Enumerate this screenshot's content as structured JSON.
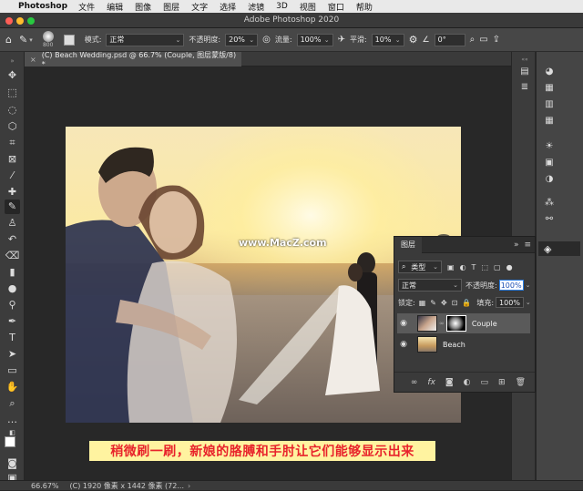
{
  "menubar": {
    "app_name": "Photoshop",
    "items": [
      "文件",
      "编辑",
      "图像",
      "图层",
      "文字",
      "选择",
      "滤镜",
      "3D",
      "视图",
      "窗口",
      "帮助"
    ]
  },
  "window": {
    "title": "Adobe Photoshop 2020"
  },
  "options": {
    "brush_size": "800",
    "mode_label": "模式:",
    "mode_value": "正常",
    "opacity_label": "不透明度:",
    "opacity_value": "20%",
    "flow_label": "流量:",
    "flow_value": "100%",
    "smooth_label": "平滑:",
    "smooth_value": "10%",
    "angle_value": "0°"
  },
  "document_tab": {
    "label": "(C) Beach Wedding.psd @ 66.7% (Couple, 图层蒙版/8) *"
  },
  "canvas": {
    "watermark": "www.MacZ.com",
    "caption": "稍微刷一刷，新娘的胳膊和手肘让它们能够显示出来"
  },
  "layers_panel": {
    "title": "图层",
    "filter_label": "类型",
    "blend_mode": "正常",
    "opacity_label": "不透明度:",
    "opacity_value": "100%",
    "lock_label": "锁定:",
    "fill_label": "填充:",
    "fill_value": "100%",
    "layers": [
      {
        "name": "Couple",
        "selected": true
      },
      {
        "name": "Beach",
        "selected": false
      }
    ]
  },
  "status": {
    "zoom": "66.67%",
    "info": "(C) 1920 像素 x 1442 像素 (72..."
  },
  "colors": {
    "caption_text": "#e8232b",
    "caption_bg": "#fff3a0",
    "selected_layer": "#5a5a5a"
  }
}
